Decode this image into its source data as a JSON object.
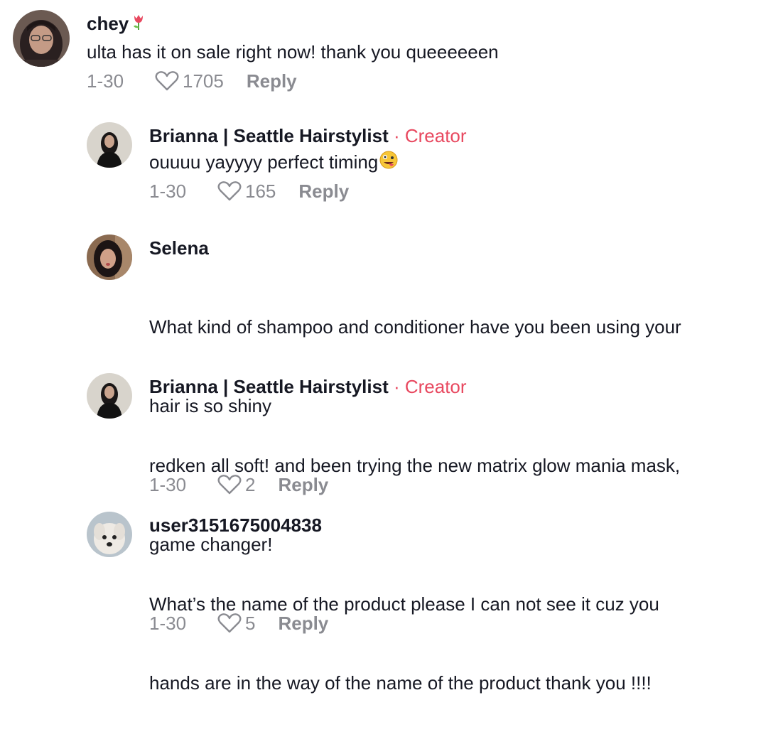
{
  "comments": [
    {
      "username": "chey",
      "text": "ulta has it on sale right now! thank you queeeeeen",
      "date": "1-30",
      "likes": "1705",
      "reply": "Reply"
    },
    {
      "username": "Brianna | Seattle Hairstylist",
      "creator_label": "· Creator",
      "text": "ouuuu yayyyy perfect timing",
      "date": "1-30",
      "likes": "165",
      "reply": "Reply"
    },
    {
      "username": "Selena",
      "text_line1": "What kind of shampoo and conditioner have you been using your",
      "text_line2": "hair is so shiny",
      "date": "1-30",
      "likes": "2",
      "reply": "Reply"
    },
    {
      "username": "Brianna | Seattle Hairstylist",
      "creator_label": "· Creator",
      "text_line1": "redken all soft! and been trying the new matrix glow mania mask,",
      "text_line2": "game changer!",
      "date": "1-30",
      "likes": "5",
      "reply": "Reply"
    },
    {
      "username": "user3151675004838",
      "text_line1": "What’s the name of the product please I can not see it cuz you",
      "text_line2": "hands are in the way of the name of the product thank you !!!!"
    }
  ],
  "colors": {
    "creator": "#e8485f",
    "meta": "#8a8b91",
    "text": "#161823"
  },
  "icons": {
    "like": "heart-outline-icon",
    "emoji_tulip": "tulip-emoji",
    "emoji_zany": "zany-face-emoji"
  }
}
